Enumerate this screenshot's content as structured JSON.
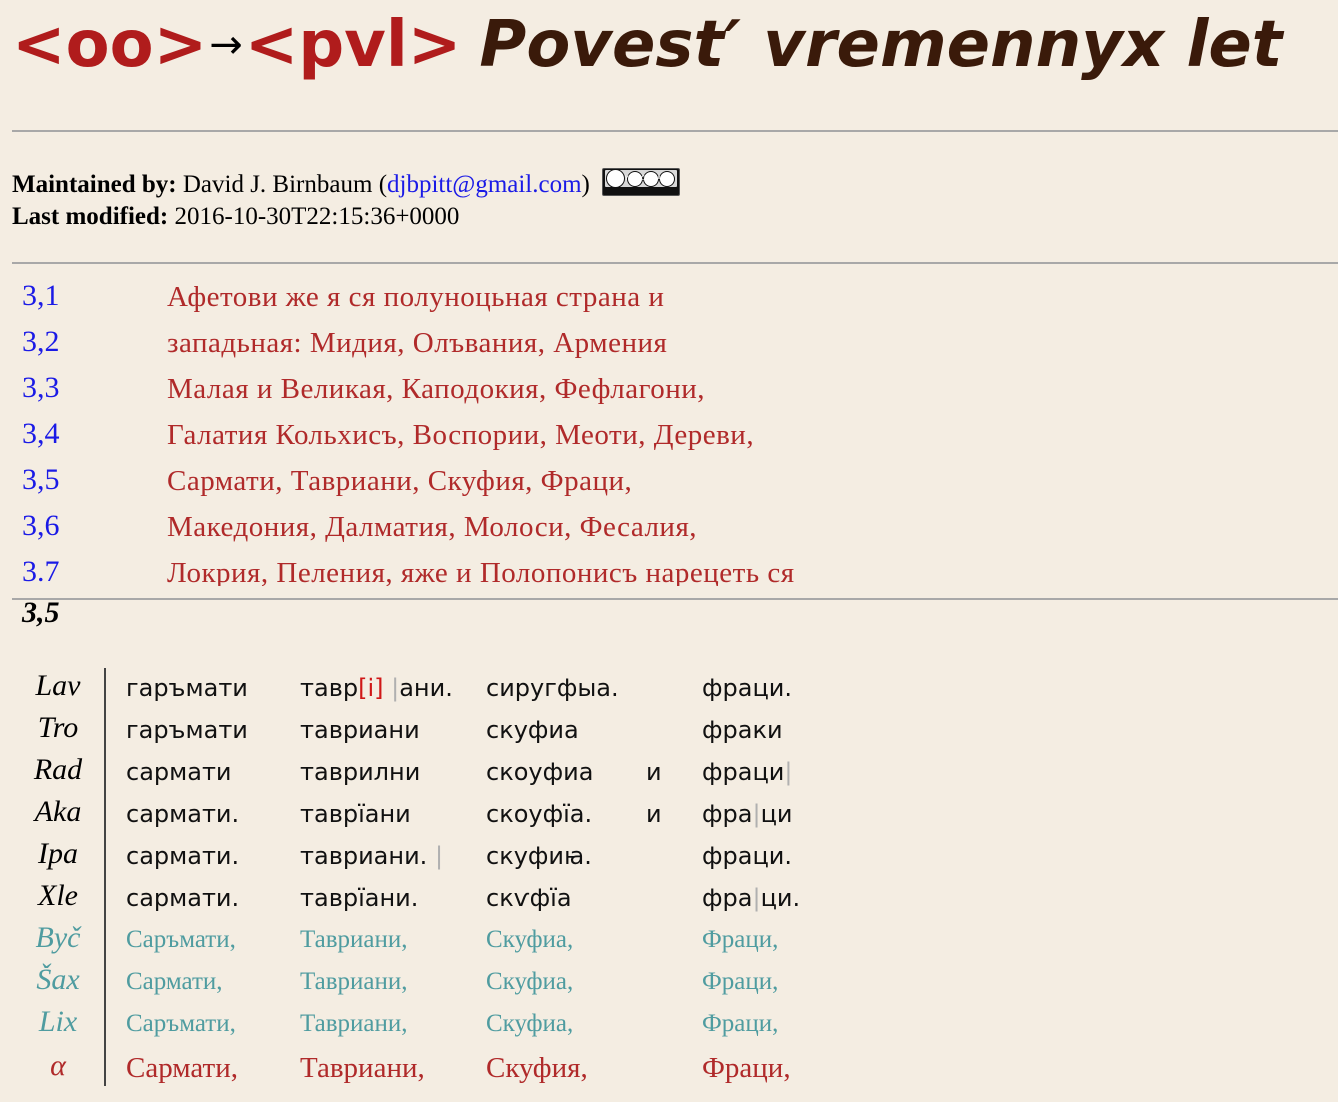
{
  "header": {
    "code_from": "<oo>",
    "arrow": "→",
    "code_to": "<pvl>",
    "title": "Povest′ vremennyx let"
  },
  "meta": {
    "maintained_label": "Maintained by:",
    "maintainer": "David J. Birnbaum",
    "email": "djbpitt@gmail.com",
    "license_badge_text": "BY NC SA",
    "modified_label": "Last modified:",
    "modified_value": "2016-10-30T22:15:36+0000"
  },
  "lines": [
    {
      "num": "3,1",
      "text": "Афетови же я ся полуноцьная страна и"
    },
    {
      "num": "3,2",
      "text": "западьная: Мидия, Олъвания, Армения"
    },
    {
      "num": "3,3",
      "text": "Малая и Великая, Каподокия, Фефлагони,"
    },
    {
      "num": "3,4",
      "text": "Галатия Кольхисъ, Воспории, Меоти, Дереви,"
    },
    {
      "num": "3,5",
      "text": "Сармати, Тавриани, Скуфия, Фраци,"
    },
    {
      "num": "3,6",
      "text": "Македония, Далматия, Молоси, Фесалия,"
    },
    {
      "num": "3.7",
      "text": "Локрия, Пеления, яже и Полопониcъ нарецеть ся"
    }
  ],
  "current_line": "3,5",
  "witnesses": [
    {
      "siglum": "Lav",
      "kind": "ms",
      "c1": "гаръмати",
      "c2a": "тавр",
      "c2e": "[і]",
      "c2b": "ани.",
      "c3": "сиругфыа.",
      "c4": "",
      "c5": "фраци."
    },
    {
      "siglum": "Tro",
      "kind": "ms",
      "c1": "гаръмати",
      "c2a": "тавриани",
      "c2e": "",
      "c2b": "",
      "c3": "скуфиа",
      "c4": "",
      "c5": "фраки"
    },
    {
      "siglum": "Rad",
      "kind": "ms",
      "c1": "сармати",
      "c2a": "таврилни",
      "c2e": "",
      "c2b": "",
      "c3": "скоуфиа",
      "c4": "и",
      "c5": "фраци"
    },
    {
      "siglum": "Aka",
      "kind": "ms",
      "c1": "сармати.",
      "c2a": "таврїани",
      "c2e": "",
      "c2b": "",
      "c3": "скоуфїа.",
      "c4": "и",
      "c5": "фра",
      "c5b": "ци"
    },
    {
      "siglum": "Ipa",
      "kind": "ms",
      "c1": "сармати.",
      "c2a": "тавриани.",
      "c2e": "",
      "c2b": "",
      "c3": "скуфиꙗ.",
      "c4": "",
      "c5": "фраци."
    },
    {
      "siglum": "Xle",
      "kind": "ms",
      "c1": "сармати.",
      "c2a": "таврїани.",
      "c2e": "",
      "c2b": "",
      "c3": "скѵфїа",
      "c4": "",
      "c5": "фра",
      "c5b": "ци."
    },
    {
      "siglum": "Byč",
      "kind": "ed",
      "c1": "Саръмати,",
      "c2a": "Тавриани,",
      "c2e": "",
      "c2b": "",
      "c3": "Скуфиа,",
      "c4": "",
      "c5": "Фраци,"
    },
    {
      "siglum": "Šax",
      "kind": "ed",
      "c1": "Сармати,",
      "c2a": "Тавриани,",
      "c2e": "",
      "c2b": "",
      "c3": "Скуфиа,",
      "c4": "",
      "c5": "Фраци,"
    },
    {
      "siglum": "Lix",
      "kind": "ed",
      "c1": "Саръмати,",
      "c2a": "Тавриани,",
      "c2e": "",
      "c2b": "",
      "c3": "Скуфиа,",
      "c4": "",
      "c5": "Фраци,"
    },
    {
      "siglum": "α",
      "kind": "alpha",
      "c1": "Сармати,",
      "c2a": "Тавриани,",
      "c2e": "",
      "c2b": "",
      "c3": "Скуфия,",
      "c4": "",
      "c5": "Фраци,"
    }
  ],
  "colors": {
    "background": "#f4ede2",
    "code_red": "#b01c1c",
    "title_brown": "#3a1a0a",
    "line_number_blue": "#1a1ae6",
    "reading_red": "#b02a2a",
    "edition_teal": "#4f9ca0"
  }
}
